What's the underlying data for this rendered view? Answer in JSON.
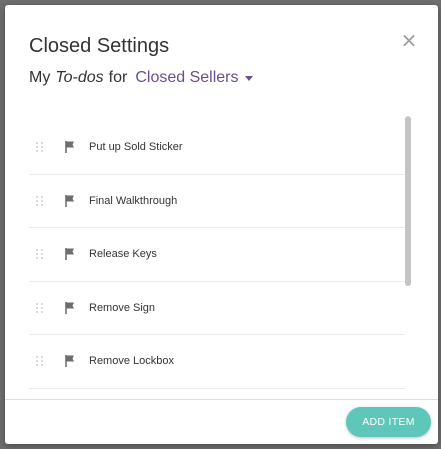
{
  "modal": {
    "title": "Closed Settings",
    "close_glyph": "×"
  },
  "subtitle": {
    "prefix": "My",
    "emphasis": "To-dos",
    "connector": "for",
    "selected_list": "Closed Sellers"
  },
  "todos": [
    {
      "label": "Put up Sold Sticker",
      "icon": "flag-icon"
    },
    {
      "label": "Final Walkthrough",
      "icon": "flag-icon"
    },
    {
      "label": "Release Keys",
      "icon": "flag-icon"
    },
    {
      "label": "Remove Sign",
      "icon": "flag-icon"
    },
    {
      "label": "Remove Lockbox",
      "icon": "flag-icon"
    }
  ],
  "footer": {
    "add_button_label": "ADD ITEM"
  },
  "colors": {
    "accent": "#5ec7b9",
    "dropdown_text": "#6b4f8c",
    "text": "#333333"
  }
}
